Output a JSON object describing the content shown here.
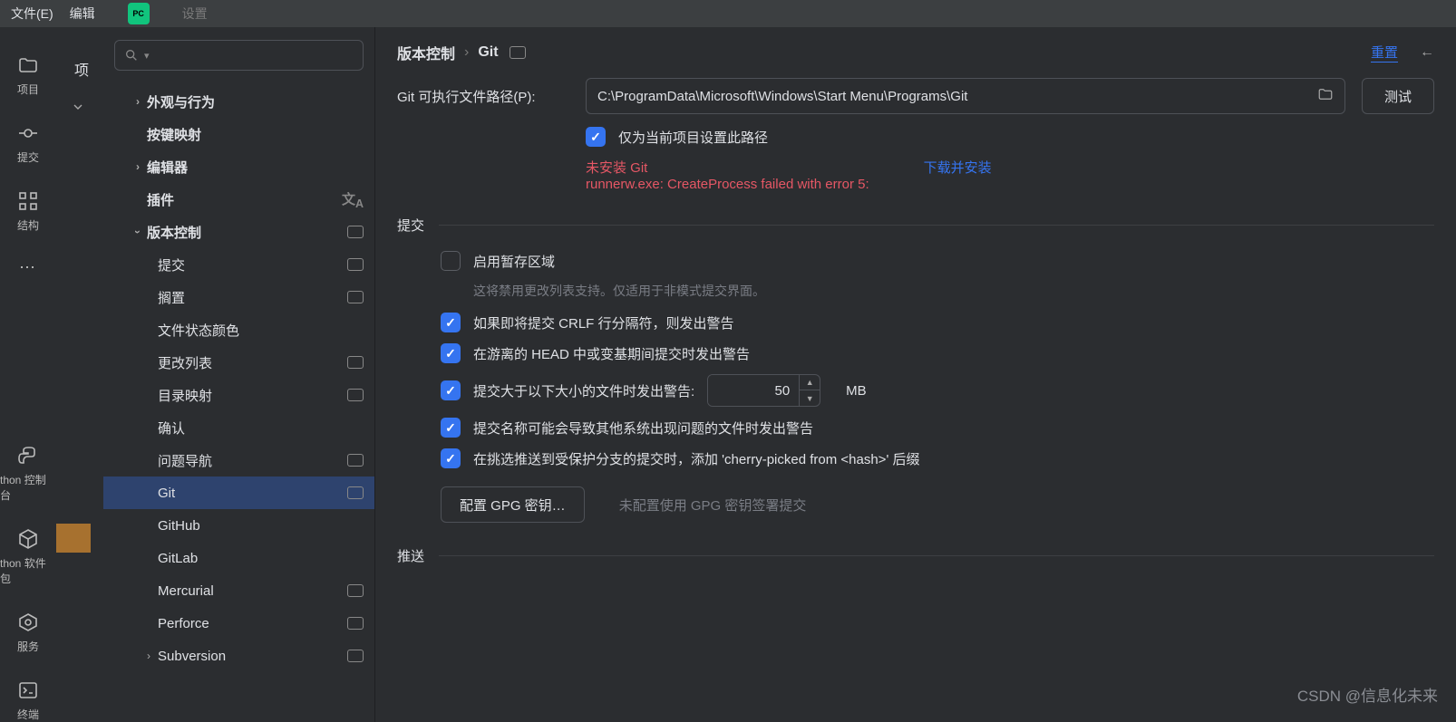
{
  "menubar": {
    "file": "文件(E)",
    "edit": "编辑",
    "settings": "设置"
  },
  "iconbar": {
    "project": "项目",
    "commit": "提交",
    "structure": "结构",
    "pyconsole": "thon 控制台",
    "packages": "thon 软件包",
    "services": "服务",
    "terminal": "终端"
  },
  "tree": {
    "appearance": "外观与行为",
    "keymap": "按键映射",
    "editor": "编辑器",
    "plugins": "插件",
    "vcs": "版本控制",
    "items": {
      "commit": "提交",
      "shelve": "搁置",
      "fileStatus": "文件状态颜色",
      "changelists": "更改列表",
      "dirMap": "目录映射",
      "confirm": "确认",
      "issueNav": "问题导航",
      "git": "Git",
      "github": "GitHub",
      "gitlab": "GitLab",
      "mercurial": "Mercurial",
      "perforce": "Perforce",
      "subversion": "Subversion"
    }
  },
  "breadcrumb": {
    "vcs": "版本控制",
    "git": "Git",
    "reset": "重置"
  },
  "form": {
    "pathLabel": "Git 可执行文件路径(P):",
    "pathValue": "C:\\ProgramData\\Microsoft\\Windows\\Start Menu\\Programs\\Git",
    "testBtn": "测试",
    "onlyProject": "仅为当前项目设置此路径",
    "errNotInstalled": "未安装 Git",
    "downloadLink": "下载并安装",
    "errRunner": "runnerw.exe: CreateProcess failed with error 5:"
  },
  "commitSection": {
    "title": "提交",
    "enableStaging": "启用暂存区域",
    "enableStagingHint": "这将禁用更改列表支持。仅适用于非模式提交界面。",
    "warnCrlf": "如果即将提交 CRLF 行分隔符，则发出警告",
    "warnDetached": "在游离的 HEAD 中或变基期间提交时发出警告",
    "warnSizeLabel": "提交大于以下大小的文件时发出警告:",
    "warnSizeValue": "50",
    "warnSizeUnit": "MB",
    "warnBadNames": "提交名称可能会导致其他系统出现问题的文件时发出警告",
    "cherryPick": "在挑选推送到受保护分支的提交时，添加 'cherry-picked from <hash>' 后缀",
    "gpgBtn": "配置 GPG 密钥…",
    "gpgHint": "未配置使用 GPG 密钥签署提交"
  },
  "pushSection": {
    "title": "推送"
  },
  "watermark": "CSDN @信息化未来"
}
